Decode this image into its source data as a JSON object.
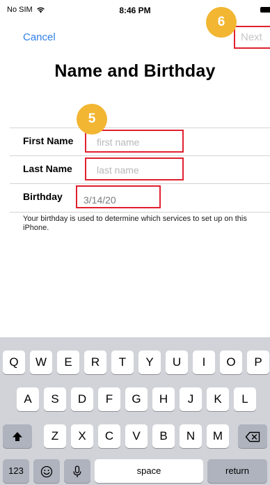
{
  "status_bar": {
    "carrier": "No SIM",
    "time": "8:46 PM"
  },
  "nav": {
    "cancel_label": "Cancel",
    "next_label": "Next"
  },
  "page": {
    "title": "Name and Birthday"
  },
  "form": {
    "first_name": {
      "label": "First Name",
      "placeholder": "first name",
      "value": ""
    },
    "last_name": {
      "label": "Last Name",
      "placeholder": "last name",
      "value": ""
    },
    "birthday": {
      "label": "Birthday",
      "value": "3/14/20"
    },
    "help_text": "Your birthday is used to determine which services to set up on this iPhone."
  },
  "annotations": {
    "step_5": "5",
    "step_6": "6"
  },
  "keyboard": {
    "row1": [
      "Q",
      "W",
      "E",
      "R",
      "T",
      "Y",
      "U",
      "I",
      "O",
      "P"
    ],
    "row2": [
      "A",
      "S",
      "D",
      "F",
      "G",
      "H",
      "J",
      "K",
      "L"
    ],
    "row3": [
      "Z",
      "X",
      "C",
      "V",
      "B",
      "N",
      "M"
    ],
    "numbers_label": "123",
    "space_label": "space",
    "return_label": "return",
    "shift_icon": "shift-icon",
    "delete_icon": "delete-icon",
    "emoji_icon": "emoji-icon",
    "mic_icon": "microphone-icon"
  },
  "colors": {
    "accent": "#2f7fe8",
    "disabled": "#c6c6c8",
    "highlight": "#e0202e",
    "badge": "#f2b632",
    "keyboard_bg": "#d1d3d9"
  }
}
